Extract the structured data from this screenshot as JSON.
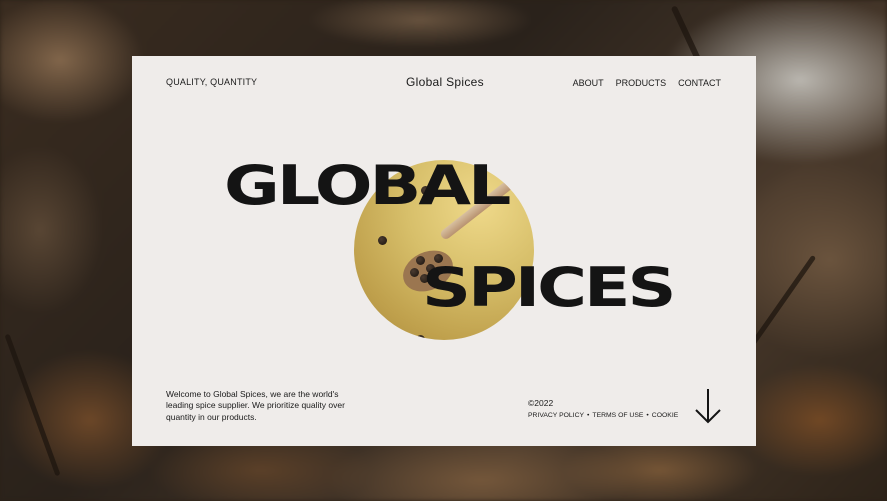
{
  "header": {
    "tagline": "QUALITY, QUANTITY",
    "brand": "Global Spices",
    "nav": [
      "ABOUT",
      "PRODUCTS",
      "CONTACT"
    ]
  },
  "hero": {
    "title_line1": "GLOBAL",
    "title_line2": "SPICES",
    "image_subject": "wooden spoon with black peppercorns on yellow background"
  },
  "footer": {
    "intro": "Welcome to Global Spices, we are the world's leading spice supplier. We prioritize quality over quantity in our products.",
    "copyright": "©2022",
    "links": [
      "PRIVACY POLICY",
      "TERMS OF USE",
      "COOKIE"
    ],
    "separator": "•",
    "scroll_icon": "arrow-down-icon"
  },
  "colors": {
    "card_background": "#efecea",
    "text": "#141414",
    "accent_gold": "#d7bf6a"
  }
}
